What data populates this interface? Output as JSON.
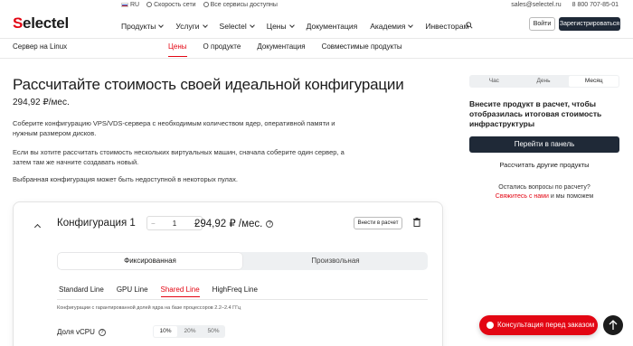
{
  "util": {
    "lang": "RU",
    "speed": "Скорость сети",
    "status": "Все сервисы доступны",
    "email": "sales@selectel.ru",
    "phone": "8 800 707-85-01"
  },
  "header": {
    "logo_rest": "electel",
    "logo_s": "S",
    "nav": [
      "Продукты",
      "Услуги",
      "Selectel",
      "Цены",
      "Документация",
      "Академия",
      "Инвесторам"
    ],
    "login": "Войти",
    "register": "Зарегистрироваться"
  },
  "subnav": {
    "product": "Сервер на Linux",
    "tabs": [
      "Цены",
      "О продукте",
      "Документация",
      "Совместимые продукты"
    ]
  },
  "main": {
    "title": "Рассчитайте стоимость своей идеальной конфигурации",
    "price": "294,92 ₽/мес.",
    "p1": "Соберите конфигурацию VPS/VDS-сервера с необходимым количеством ядер, оперативной памяти и нужным размером дисков.",
    "p2": "Если вы хотите рассчитать стоимость нескольких виртуальных машин, сначала соберите один сервер, а затем там же начните создавать новый.",
    "p3": "Выбранная конфигурация может быть недоступной в некоторых пулах."
  },
  "config": {
    "title": "Конфигурация 1",
    "qty": "1",
    "minus": "−",
    "plus": "+",
    "price": "294,92 ₽ /мес.",
    "add_btn": "Внести в расчет",
    "modes": [
      "Фиксированная",
      "Произвольная"
    ],
    "lines": [
      "Standard Line",
      "GPU Line",
      "Shared Line",
      "HighFreq Line"
    ],
    "line_note": "Конфигурации с гарантированной долей ядра на базе процессоров 2.2–2.4 ГГц",
    "vcpu_label": "Доля vCPU",
    "vcpu_opts": [
      "10%",
      "20%",
      "50%"
    ]
  },
  "right": {
    "periods": [
      "Час",
      "День",
      "Месяц"
    ],
    "text": "Внесите продукт в расчет, чтобы отобразилась итоговая стоимость инфраструктуры",
    "go": "Перейти в панель",
    "calc": "Рассчитать другие продукты",
    "q1": "Остались вопросы по расчету?",
    "q_link": "Свяжитесь с нами",
    "q2": "и мы поможем"
  },
  "consult": "Консультация перед заказом",
  "colors": {
    "brand_red": "#e30613",
    "dark": "#1f2937"
  }
}
